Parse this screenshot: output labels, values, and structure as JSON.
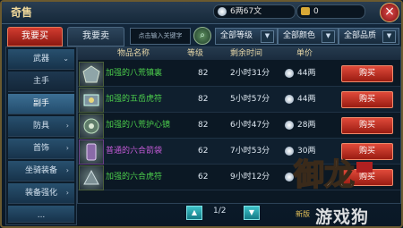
{
  "window": {
    "title": "奇售",
    "money": "6两67文",
    "gold": "0"
  },
  "tabs": {
    "buy": "我要买",
    "sell": "我要卖"
  },
  "search": {
    "placeholder": "点击输入关键字"
  },
  "filters": [
    {
      "label": "全部等级"
    },
    {
      "label": "全部颜色"
    },
    {
      "label": "全部品质"
    }
  ],
  "sidebar": {
    "items": [
      {
        "label": "武器",
        "type": "category"
      },
      {
        "label": "主手",
        "type": "sub"
      },
      {
        "label": "副手",
        "type": "selected"
      },
      {
        "label": "防具",
        "type": "category"
      },
      {
        "label": "首饰",
        "type": "category"
      },
      {
        "label": "坐骑装备",
        "type": "category"
      },
      {
        "label": "装备强化",
        "type": "category"
      },
      {
        "label": "...",
        "type": "category"
      }
    ]
  },
  "table": {
    "headers": {
      "name": "物品名称",
      "level": "等级",
      "time": "剩余时间",
      "price": "单价"
    },
    "rows": [
      {
        "name": "加强的八荒镇裏",
        "level": "82",
        "time": "2小时31分",
        "price": "44两",
        "color": "green",
        "buy": "购买"
      },
      {
        "name": "加强的五岳虎符",
        "level": "82",
        "time": "5小时57分",
        "price": "44两",
        "color": "green",
        "buy": "购买"
      },
      {
        "name": "加强的八荒护心镜",
        "level": "82",
        "time": "6小时47分",
        "price": "28两",
        "color": "green",
        "buy": "购买"
      },
      {
        "name": "普通的六合箭袋",
        "level": "62",
        "time": "7小时53分",
        "price": "30两",
        "color": "purple",
        "buy": "购买"
      },
      {
        "name": "加强的六合虎符",
        "level": "62",
        "time": "9小时12分",
        "price": "",
        "color": "green",
        "buy": "购买"
      }
    ]
  },
  "pager": {
    "page": "1/2"
  },
  "watermark": {
    "logo": "御龙",
    "site": "游戏狗",
    "tag": "新版"
  }
}
